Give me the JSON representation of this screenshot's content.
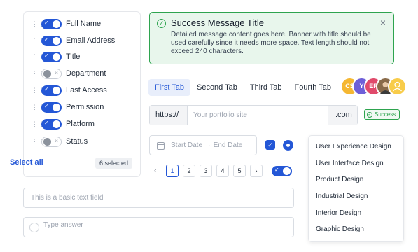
{
  "columns": {
    "items": [
      {
        "label": "Full Name",
        "enabled": true
      },
      {
        "label": "Email Address",
        "enabled": true
      },
      {
        "label": "Title",
        "enabled": true
      },
      {
        "label": "Department",
        "enabled": false
      },
      {
        "label": "Last Access",
        "enabled": true
      },
      {
        "label": "Permission",
        "enabled": true
      },
      {
        "label": "Platform",
        "enabled": true
      },
      {
        "label": "Status",
        "enabled": false
      }
    ],
    "select_all": "Select all",
    "selected_count": "6 selected"
  },
  "banner": {
    "title": "Success Message Title",
    "message": "Detailed message content goes here. Banner with title should be used carefully since it needs more space. Text length should not exceed 240 characters."
  },
  "tabs": [
    "First Tab",
    "Second Tab",
    "Third Tab",
    "Fourth Tab"
  ],
  "avatars": [
    {
      "initials": "CS",
      "color": "#f5b731"
    },
    {
      "initials": "Y",
      "color": "#6e5fd8"
    },
    {
      "initials": "ER",
      "color": "#e04a6b"
    },
    {
      "initials": "",
      "color": "#8a6b4a"
    },
    {
      "initials": "",
      "color": "#f8cc4a"
    }
  ],
  "url_input": {
    "prefix": "https://",
    "placeholder": "Your portfolio site",
    "suffix": ".com"
  },
  "success_tag": "Success",
  "date_range": {
    "start": "Start Date",
    "arrow": "→",
    "end": "End Date"
  },
  "pagination": [
    "1",
    "2",
    "3",
    "4",
    "5"
  ],
  "menu": [
    "User Experience Design",
    "User Interface Design",
    "Product Design",
    "Industrial Design",
    "Interior Design",
    "Graphic Design"
  ],
  "text_field": {
    "placeholder": "This is a basic text field"
  },
  "answer_field": {
    "placeholder": "Type answer"
  },
  "colors": {
    "primary": "#2457d6",
    "success": "#2ea44f"
  }
}
